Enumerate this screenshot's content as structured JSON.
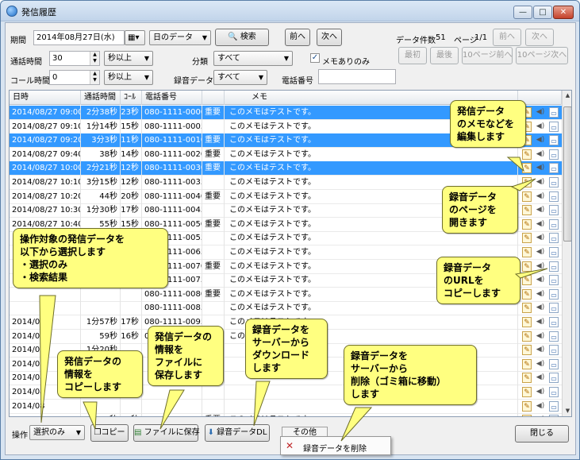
{
  "window": {
    "title": "発信履歴",
    "min": "—",
    "max": "□",
    "close": "✕"
  },
  "toolbar": {
    "period_label": "期間",
    "date_value": "2014年08月27日(水)",
    "date_btn": "▦▾",
    "range_value": "日のデータ",
    "search_label": "検索",
    "prev_label": "前へ",
    "next_label": "次へ",
    "count_label": "データ件数",
    "count_value": "51",
    "page_label": "ページ",
    "page_value": "1/1",
    "page_prev": "前へ",
    "page_next": "次へ",
    "first": "最初",
    "last": "最後",
    "prev10": "10ページ前へ",
    "next10": "10ページ次へ",
    "call_time_label": "通話時間",
    "call_time_value": "30",
    "call_time_unit": "秒以上",
    "category_label": "分類",
    "category_value": "すべて",
    "memo_only_label": "メモありのみ",
    "memo_only_checked": "✓",
    "call_count_label": "コール時間",
    "call_count_value": "0",
    "call_count_unit": "秒以上",
    "rec_label": "録音データ",
    "rec_value": "すべて",
    "phone_label": "電話番号",
    "phone_value": ""
  },
  "grid": {
    "headers": [
      "日時",
      "通話時間",
      "ｺｰﾙ",
      "電話番号",
      "",
      "メモ"
    ],
    "rows": [
      {
        "dt": "2014/08/27 09:00",
        "dur": "2分38秒",
        "call": "23秒",
        "tel": "080-1111-0000",
        "imp": "重要",
        "memo": "このメモはテストです。",
        "sel": true
      },
      {
        "dt": "2014/08/27 09:10",
        "dur": "1分14秒",
        "call": "15秒",
        "tel": "080-1111-0005",
        "imp": "",
        "memo": "このメモはテストです。",
        "sel": false
      },
      {
        "dt": "2014/08/27 09:20",
        "dur": "3分3秒",
        "call": "11秒",
        "tel": "080-1111-0010",
        "imp": "重要",
        "memo": "このメモはテストです。",
        "sel": true
      },
      {
        "dt": "2014/08/27 09:40",
        "dur": "38秒",
        "call": "14秒",
        "tel": "080-1111-0020",
        "imp": "重要",
        "memo": "このメモはテストです。",
        "sel": false
      },
      {
        "dt": "2014/08/27 10:00",
        "dur": "2分21秒",
        "call": "12秒",
        "tel": "080-1111-0030",
        "imp": "重要",
        "memo": "このメモはテストです。",
        "sel": true
      },
      {
        "dt": "2014/08/27 10:10",
        "dur": "3分15秒",
        "call": "12秒",
        "tel": "080-1111-0035",
        "imp": "",
        "memo": "このメモはテストです。",
        "sel": false
      },
      {
        "dt": "2014/08/27 10:20",
        "dur": "44秒",
        "call": "20秒",
        "tel": "080-1111-0040",
        "imp": "重要",
        "memo": "このメモはテストです。",
        "sel": false
      },
      {
        "dt": "2014/08/27 10:30",
        "dur": "1分30秒",
        "call": "17秒",
        "tel": "080-1111-0045",
        "imp": "",
        "memo": "このメモはテストです。",
        "sel": false
      },
      {
        "dt": "2014/08/27 10:40",
        "dur": "55秒",
        "call": "15秒",
        "tel": "080-1111-0050",
        "imp": "重要",
        "memo": "このメモはテストです。",
        "sel": false
      },
      {
        "dt": "",
        "dur": "",
        "call": "",
        "tel": "080-1111-0055",
        "imp": "",
        "memo": "このメモはテストです。",
        "sel": false
      },
      {
        "dt": "",
        "dur": "",
        "call": "",
        "tel": "080-1111-0065",
        "imp": "",
        "memo": "このメモはテストです。",
        "sel": false
      },
      {
        "dt": "",
        "dur": "",
        "call": "",
        "tel": "080-1111-0070",
        "imp": "重要",
        "memo": "このメモはテストです。",
        "sel": false
      },
      {
        "dt": "",
        "dur": "",
        "call": "",
        "tel": "080-1111-0075",
        "imp": "",
        "memo": "このメモはテストです。",
        "sel": false
      },
      {
        "dt": "",
        "dur": "",
        "call": "",
        "tel": "080-1111-0080",
        "imp": "重要",
        "memo": "このメモはテストです。",
        "sel": false
      },
      {
        "dt": "",
        "dur": "",
        "call": "",
        "tel": "080-1111-0085",
        "imp": "",
        "memo": "このメモはテストです。",
        "sel": false
      },
      {
        "dt": "2014/08",
        "dur": "1分57秒",
        "call": "17秒",
        "tel": "080-1111-0095",
        "imp": "",
        "memo": "このメモはテストです。",
        "sel": false
      },
      {
        "dt": "2014/08",
        "dur": "59秒",
        "call": "16秒",
        "tel": "080-1111-0100",
        "imp": "重要",
        "memo": "このメモはテストです。",
        "sel": false
      },
      {
        "dt": "2014/08",
        "dur": "1分20秒",
        "call": "",
        "tel": "",
        "imp": "",
        "memo": "",
        "sel": false
      },
      {
        "dt": "2014/08",
        "dur": "",
        "call": "",
        "tel": "",
        "imp": "",
        "memo": "",
        "sel": false
      },
      {
        "dt": "2014/08",
        "dur": "",
        "call": "",
        "tel": "",
        "imp": "",
        "memo": "",
        "sel": false
      },
      {
        "dt": "2014/08",
        "dur": "",
        "call": "",
        "tel": "",
        "imp": "",
        "memo": "",
        "sel": false
      },
      {
        "dt": "2014/08",
        "dur": "",
        "call": "",
        "tel": "",
        "imp": "",
        "memo": "",
        "sel": false
      },
      {
        "dt": "2014/08/27 13:40",
        "dur": "52秒",
        "call": "14秒",
        "tel": "0-1111-0140",
        "imp": "重要",
        "memo": "このメモはテストです。",
        "sel": false
      }
    ]
  },
  "bottom": {
    "op_label": "操作",
    "op_value": "選択のみ",
    "copy_label": "コピー",
    "save_label": "ファイルに保存",
    "dl_label": "録音データDL",
    "other_label": "その他",
    "close_label": "閉じる",
    "delete_label": "録音データを削除"
  },
  "callouts": {
    "memo_edit": "発信データ\nのメモなどを\n編集します",
    "rec_page": "録音データ\nのページを\n開きます",
    "rec_url": "録音データ\nのURLを\nコピーします",
    "target": "操作対象の発信データを\n以下から選択します\n・選択のみ\n・検索結果",
    "copy": "発信データの\n情報を\nコピーします",
    "save": "発信データの\n情報を\nファイルに\n保存します",
    "download": "録音データを\nサーバーから\nダウンロード\nします",
    "delete": "録音データを\nサーバーから\n削除（ゴミ箱に移動）\nします"
  },
  "colors": {
    "selection": "#3399ff",
    "callout": "#ffff80"
  }
}
